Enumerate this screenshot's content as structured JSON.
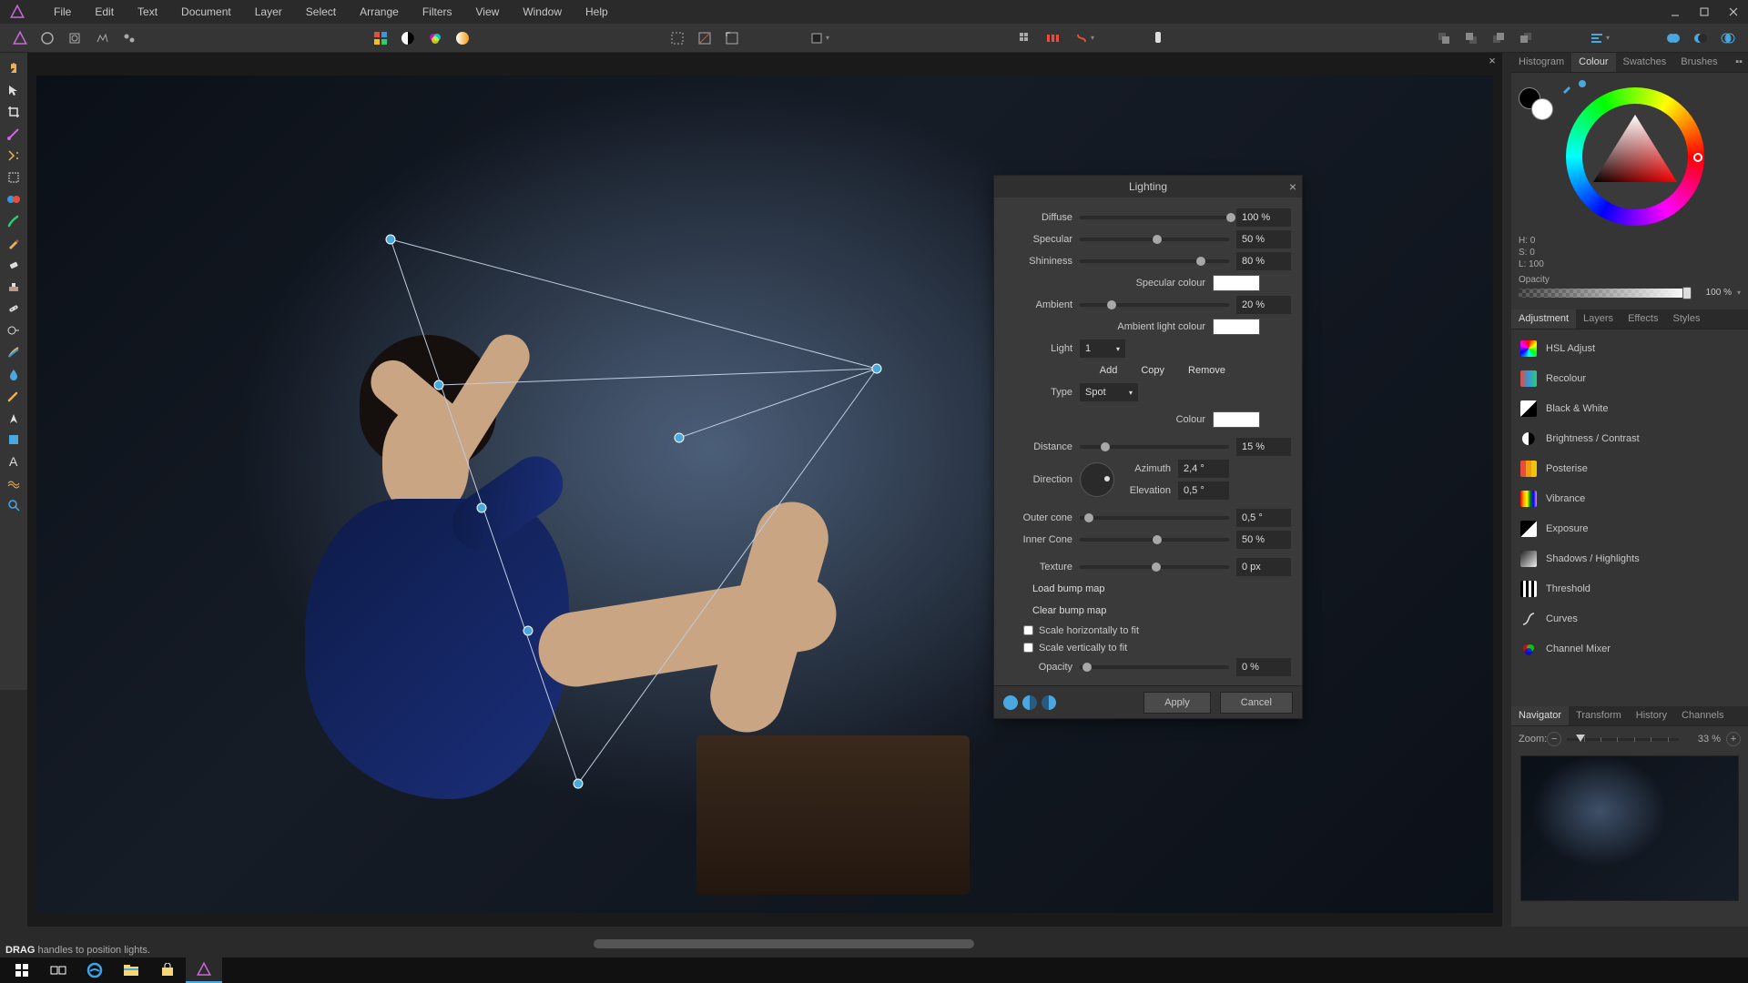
{
  "menu": [
    "File",
    "Edit",
    "Text",
    "Document",
    "Layer",
    "Select",
    "Arrange",
    "Filters",
    "View",
    "Window",
    "Help"
  ],
  "lighting": {
    "title": "Lighting",
    "diffuse": {
      "label": "Diffuse",
      "value": "100 %",
      "pos": 98
    },
    "specular": {
      "label": "Specular",
      "value": "50 %",
      "pos": 49
    },
    "shininess": {
      "label": "Shininess",
      "value": "80 %",
      "pos": 78
    },
    "specular_colour_label": "Specular colour",
    "ambient": {
      "label": "Ambient",
      "value": "20 %",
      "pos": 18
    },
    "ambient_colour_label": "Ambient light colour",
    "light_label": "Light",
    "light_value": "1",
    "add": "Add",
    "copy": "Copy",
    "remove": "Remove",
    "type_label": "Type",
    "type_value": "Spot",
    "colour_label": "Colour",
    "distance": {
      "label": "Distance",
      "value": "15 %",
      "pos": 14
    },
    "direction_label": "Direction",
    "azimuth": {
      "label": "Azimuth",
      "value": "2,4 °"
    },
    "elevation": {
      "label": "Elevation",
      "value": "0,5 °"
    },
    "outer_cone": {
      "label": "Outer cone",
      "value": "0,5 °",
      "pos": 3
    },
    "inner_cone": {
      "label": "Inner Cone",
      "value": "50 %",
      "pos": 49
    },
    "texture": {
      "label": "Texture",
      "value": "0 px",
      "pos": 48
    },
    "load_bump": "Load bump map",
    "clear_bump": "Clear bump map",
    "scale_h": "Scale horizontally to fit",
    "scale_v": "Scale vertically to fit",
    "opacity": {
      "label": "Opacity",
      "value": "0 %",
      "pos": 2
    },
    "apply": "Apply",
    "cancel": "Cancel"
  },
  "studio": {
    "colour_tabs": [
      "Histogram",
      "Colour",
      "Swatches",
      "Brushes"
    ],
    "colour_active": 1,
    "hsl": {
      "h": "H: 0",
      "s": "S: 0",
      "l": "L: 100"
    },
    "opacity_label": "Opacity",
    "opacity_value": "100 %",
    "adj_tabs": [
      "Adjustment",
      "Layers",
      "Effects",
      "Styles"
    ],
    "adj_active": 0,
    "adjustments": [
      "HSL Adjust",
      "Recolour",
      "Black & White",
      "Brightness / Contrast",
      "Posterise",
      "Vibrance",
      "Exposure",
      "Shadows / Highlights",
      "Threshold",
      "Curves",
      "Channel Mixer"
    ],
    "nav_tabs": [
      "Navigator",
      "Transform",
      "History",
      "Channels"
    ],
    "nav_active": 0,
    "zoom_label": "Zoom:",
    "zoom_value": "33 %"
  },
  "hint_bold": "DRAG",
  "hint_rest": " handles to position lights."
}
